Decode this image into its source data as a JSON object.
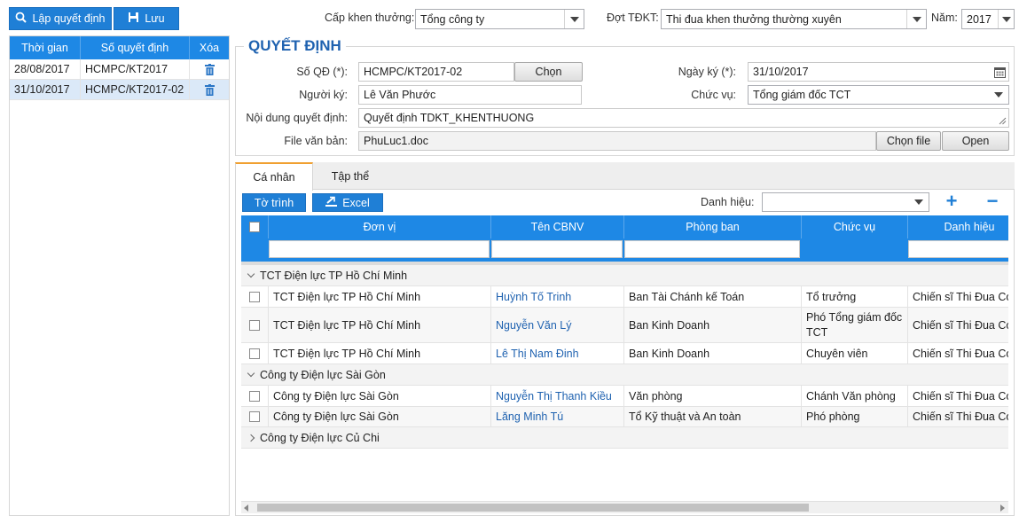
{
  "toolbar": {
    "create_label": "Lập quyết định",
    "save_label": "Lưu"
  },
  "filters": {
    "level_label": "Cấp khen thưởng:",
    "level_value": "Tổng công ty",
    "period_label": "Đợt TĐKT:",
    "period_value": "Thi đua khen thưởng thường xuyên",
    "year_label": "Năm:",
    "year_value": "2017"
  },
  "decision_list": {
    "headers": [
      "Thời gian",
      "Số quyết định",
      "Xóa"
    ],
    "rows": [
      {
        "date": "28/08/2017",
        "number": "HCMPC/KT2017"
      },
      {
        "date": "31/10/2017",
        "number": "HCMPC/KT2017-02"
      }
    ]
  },
  "form": {
    "title": "QUYẾT ĐỊNH",
    "number_label": "Số QĐ (*):",
    "number_value": "HCMPC/KT2017-02",
    "choose_label": "Chọn",
    "sign_date_label": "Ngày ký (*):",
    "sign_date_value": "31/10/2017",
    "signer_label": "Người ký:",
    "signer_value": "Lê Văn Phước",
    "position_label": "Chức vụ:",
    "position_value": "Tổng giám đốc TCT",
    "content_label": "Nội dung quyết định:",
    "content_value": "Quyết định TDKT_KHENTHUONG",
    "file_label": "File văn bản:",
    "file_value": "PhuLuc1.doc",
    "choose_file_label": "Chọn file",
    "open_label": "Open"
  },
  "tabs": {
    "individual": "Cá nhân",
    "group": "Tập thể"
  },
  "grid_toolbar": {
    "submit_label": "Tờ trình",
    "excel_label": "Excel",
    "title_label": "Danh hiệu:",
    "title_value": "",
    "add_symbol": "+",
    "remove_symbol": "−"
  },
  "grid": {
    "headers": [
      "Đơn vị",
      "Tên CBNV",
      "Phòng ban",
      "Chức vụ",
      "Danh hiệu"
    ],
    "groups": [
      {
        "name": "TCT Điện lực TP Hồ Chí Minh",
        "expanded": true,
        "rows": [
          {
            "unit": "TCT Điện lực TP Hồ Chí Minh",
            "name": "Huỳnh Tố Trinh",
            "dept": "Ban Tài Chánh kế Toán",
            "position": "Tổ trưởng",
            "title": "Chiến sĩ Thi Đua Cơ sở"
          },
          {
            "unit": "TCT Điện lực TP Hồ Chí Minh",
            "name": "Nguyễn Văn Lý",
            "dept": "Ban Kinh Doanh",
            "position": "Phó Tổng giám đốc TCT",
            "title": "Chiến sĩ Thi Đua Cơ sở"
          },
          {
            "unit": "TCT Điện lực TP Hồ Chí Minh",
            "name": "Lê Thị Nam Đinh",
            "dept": "Ban Kinh Doanh",
            "position": "Chuyên viên",
            "title": "Chiến sĩ Thi Đua Cơ sở"
          }
        ]
      },
      {
        "name": "Công ty Điện lực Sài Gòn",
        "expanded": true,
        "rows": [
          {
            "unit": "Công ty Điện lực Sài Gòn",
            "name": "Nguyễn Thị Thanh Kiều",
            "dept": "Văn phòng",
            "position": "Chánh Văn phòng",
            "title": "Chiến sĩ Thi Đua Cơ sở"
          },
          {
            "unit": "Công ty Điện lực Sài Gòn",
            "name": "Lăng Minh Tú",
            "dept": "Tổ Kỹ thuật và An toàn",
            "position": "Phó phòng",
            "title": "Chiến sĩ Thi Đua Cơ sở"
          }
        ]
      },
      {
        "name": "Công ty Điện lực Củ Chi",
        "expanded": false,
        "rows": []
      }
    ]
  },
  "colors": {
    "accent": "#1e88e5",
    "title": "#1f62b0",
    "selected_row": "#dbe9f8"
  }
}
